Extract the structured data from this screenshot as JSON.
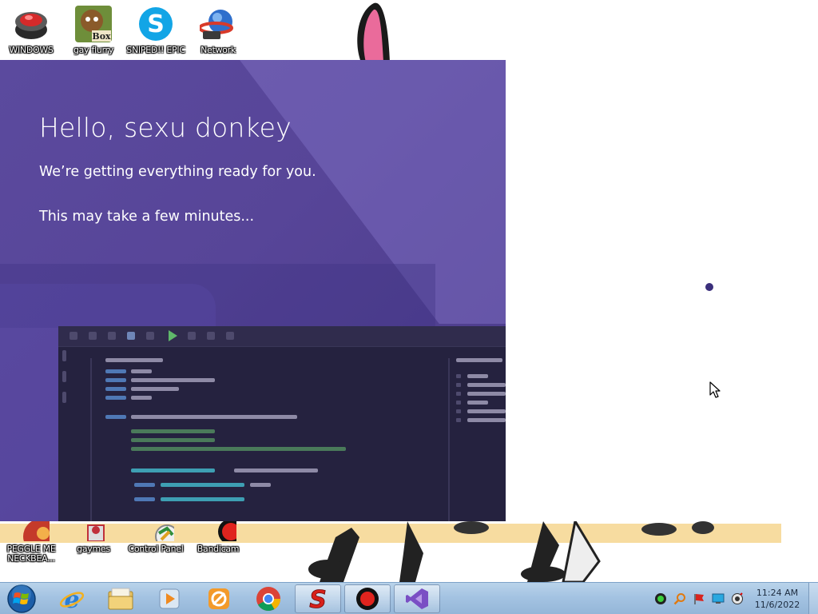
{
  "desktop_icons_top": [
    {
      "label": "WINDOWS",
      "icon": "red-cup-icon"
    },
    {
      "label": "gay flurry",
      "icon": "box-game-icon"
    },
    {
      "label": "SNIPED!! EPIC",
      "icon": "skype-icon"
    },
    {
      "label": "Network",
      "icon": "network-globe-icon"
    }
  ],
  "desktop_icons_bottom": [
    {
      "label": "PEGGLE ME NECKBEA...",
      "icon": "peggle-icon"
    },
    {
      "label": "gaymes",
      "icon": "folder-icon"
    },
    {
      "label": "Control Panel",
      "icon": "control-panel-icon"
    },
    {
      "label": "Bandicam",
      "icon": "bandicam-icon"
    }
  ],
  "installer": {
    "greeting": "Hello, sexu donkey",
    "status": "We’re getting everything ready for you.",
    "wait": "This may take a few minutes..."
  },
  "taskbar": {
    "items": [
      {
        "name": "internet-explorer",
        "icon": "ie-icon"
      },
      {
        "name": "windows-explorer",
        "icon": "folder-icon"
      },
      {
        "name": "media-player",
        "icon": "media-player-icon"
      },
      {
        "name": "bandizip",
        "icon": "bandizip-icon"
      },
      {
        "name": "chrome",
        "icon": "chrome-icon"
      },
      {
        "name": "app-s",
        "icon": "red-s-icon"
      },
      {
        "name": "bandicam",
        "icon": "record-icon"
      },
      {
        "name": "visual-studio-installer",
        "icon": "visual-studio-icon"
      }
    ],
    "clock_time": "11:24 AM",
    "clock_date": "11/6/2022"
  },
  "colors": {
    "installer_bg": "#574598",
    "spinner": "#3b2f7c",
    "taskbar": "#a4c3e2"
  }
}
